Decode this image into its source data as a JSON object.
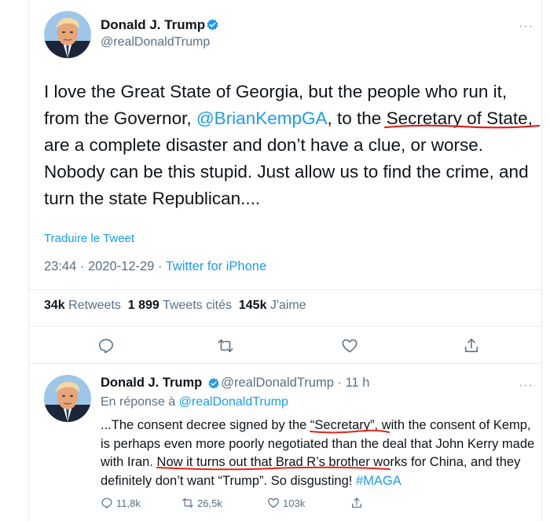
{
  "main_tweet": {
    "author_name": "Donald J. Trump",
    "author_handle": "@realDonaldTrump",
    "more": "···",
    "text_part1": "I love the Great State of Georgia, but the people who run it, from the Governor, ",
    "mention": "@BrianKempGA",
    "text_part2": ", to the ",
    "highlight": "Secretary of State,",
    "text_part3": " are a complete disaster and don’t have a clue, or worse. Nobody can be this stupid. Just allow us to find the crime, and turn the state Republican....",
    "translate": "Traduire le Tweet",
    "time": "23:44 · 2020-12-29 · ",
    "source": "Twitter for iPhone",
    "retweets_count": "34k",
    "retweets_label": "Retweets",
    "quotes_count": "1 899",
    "quotes_label": "Tweets cités",
    "likes_count": "145k",
    "likes_label": "J'aime"
  },
  "reply_tweet": {
    "author_name": "Donald J. Trump",
    "author_handle": "@realDonaldTrump",
    "time": "· 11 h",
    "more": "···",
    "reply_to_prefix": "En réponse à ",
    "reply_to_handle": "@realDonaldTrump",
    "text_a": "...The consent decree signed by the ",
    "text_ul1": "“Secretary”,",
    "text_b": " with the consent of Kemp, is perhaps even more poorly negotiated than the deal that John Kerry made with Iran. ",
    "text_ul2": "Now it turns out that Brad R’s brother",
    "text_c": " works for China, and they definitely don’t want “Trump”. So disgusting! ",
    "hashtag": "#MAGA",
    "replies": "11,8k",
    "retweets": "26,5k",
    "likes": "103k"
  },
  "colors": {
    "link": "#1d9bf0",
    "muted": "#5b7083",
    "annotation": "#e0251b",
    "verified": "#1d9bf0"
  },
  "icons": [
    "reply-icon",
    "retweet-icon",
    "like-icon",
    "share-icon",
    "verified-badge-icon",
    "more-icon"
  ]
}
